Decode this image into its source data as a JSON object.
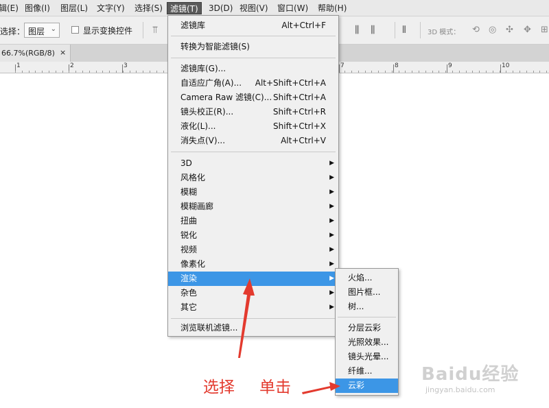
{
  "menubar": {
    "items": [
      "辑(E)",
      "图像(I)",
      "图层(L)",
      "文字(Y)",
      "选择(S)",
      "滤镜(T)",
      "3D(D)",
      "视图(V)",
      "窗口(W)",
      "帮助(H)"
    ]
  },
  "options": {
    "select_label": "选择：",
    "select_value": "图层",
    "checkbox_label": "显示变换控件",
    "mode_label": "3D 模式："
  },
  "tab": {
    "title": "66.7%(RGB/8)",
    "close": "×"
  },
  "ruler": {
    "numbers": [
      "1",
      "2",
      "3",
      "7",
      "8",
      "9",
      "10"
    ]
  },
  "filter_menu": {
    "top_item": {
      "label": "滤镜库",
      "shortcut": "Alt+Ctrl+F"
    },
    "smart": {
      "label": "转换为智能滤镜(S)"
    },
    "group1": [
      {
        "label": "滤镜库(G)...",
        "shortcut": ""
      },
      {
        "label": "自适应广角(A)...",
        "shortcut": "Alt+Shift+Ctrl+A"
      },
      {
        "label": "Camera Raw 滤镜(C)...",
        "shortcut": "Shift+Ctrl+A"
      },
      {
        "label": "镜头校正(R)...",
        "shortcut": "Shift+Ctrl+R"
      },
      {
        "label": "液化(L)...",
        "shortcut": "Shift+Ctrl+X"
      },
      {
        "label": "消失点(V)...",
        "shortcut": "Alt+Ctrl+V"
      }
    ],
    "group2": [
      "3D",
      "风格化",
      "模糊",
      "模糊画廊",
      "扭曲",
      "锐化",
      "视频",
      "像素化",
      "渲染",
      "杂色",
      "其它"
    ],
    "browse": {
      "label": "浏览联机滤镜..."
    }
  },
  "render_submenu": {
    "group1": [
      "火焰...",
      "图片框...",
      "树..."
    ],
    "group2": [
      "分层云彩",
      "光照效果...",
      "镜头光晕...",
      "纤维...",
      "云彩"
    ]
  },
  "annotations": {
    "select": "选择",
    "click": "单击"
  },
  "watermark": {
    "main": "Baidu经验",
    "sub": "jingyan.baidu.com"
  },
  "colors": {
    "highlight": "#3c96e6",
    "annotation": "#e33a2e"
  }
}
